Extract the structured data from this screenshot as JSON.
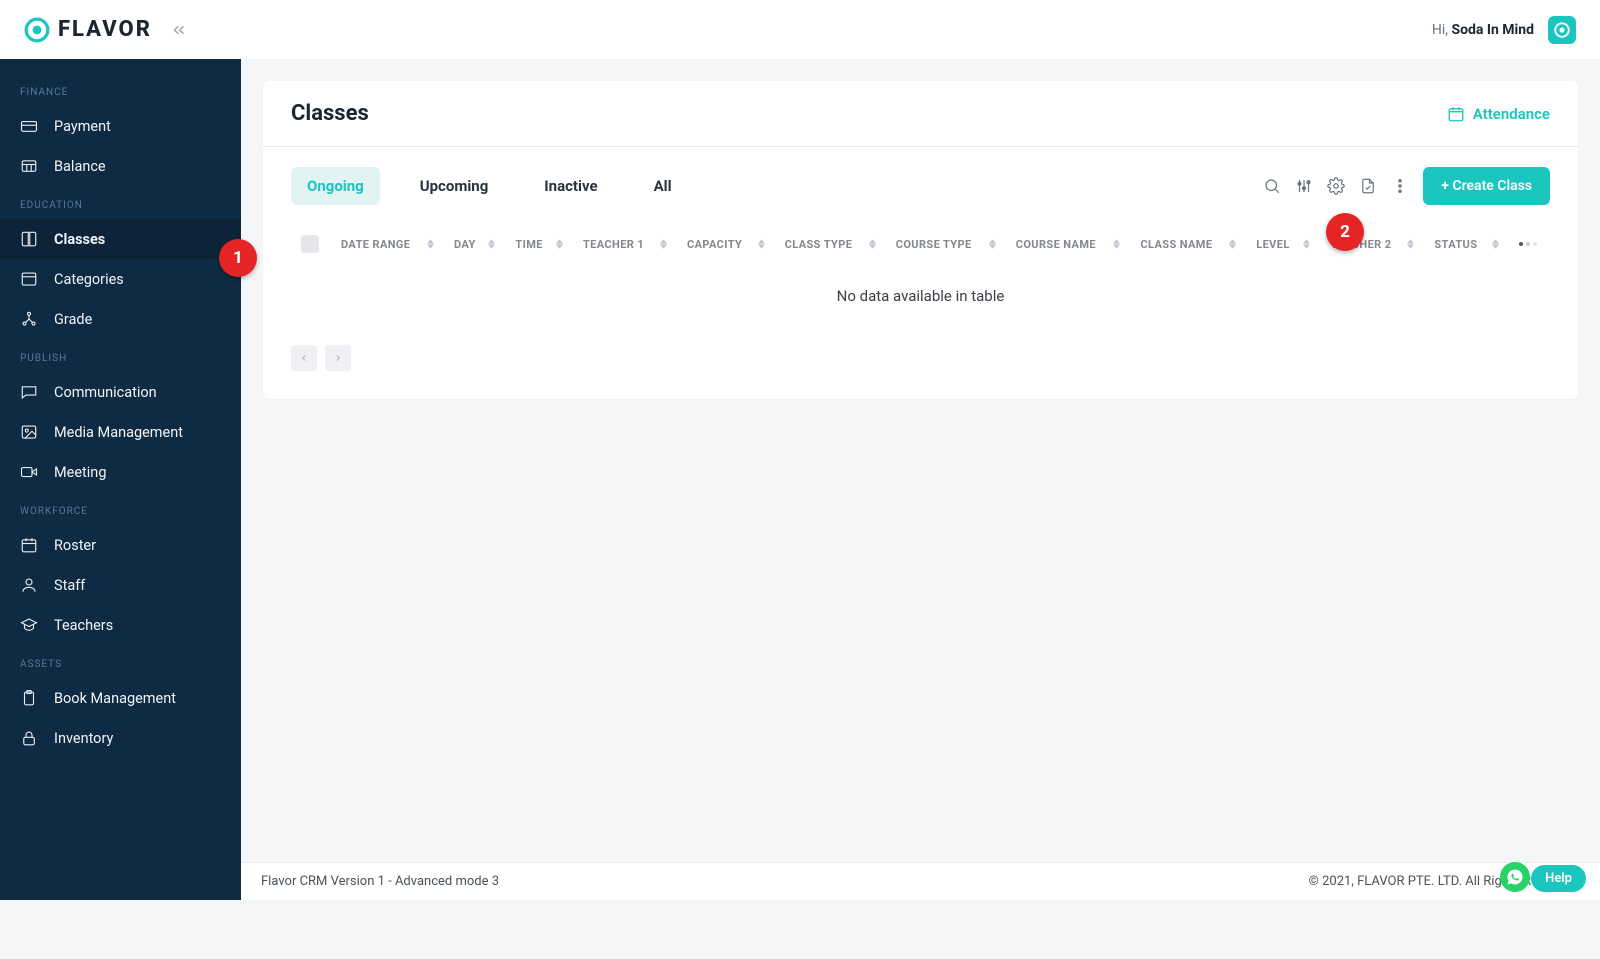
{
  "brand": {
    "name": "FLAVOR"
  },
  "user": {
    "greeting_prefix": "Hi, ",
    "name": "Soda In Mind"
  },
  "markers": {
    "one": "1",
    "two": "2"
  },
  "sidebar": {
    "sections": [
      {
        "title": "FINANCE",
        "items": [
          {
            "label": "Payment",
            "icon": "card-icon"
          },
          {
            "label": "Balance",
            "icon": "table-icon"
          }
        ]
      },
      {
        "title": "EDUCATION",
        "items": [
          {
            "label": "Classes",
            "icon": "book-icon",
            "active": true
          },
          {
            "label": "Categories",
            "icon": "window-icon"
          },
          {
            "label": "Grade",
            "icon": "distribute-icon"
          }
        ]
      },
      {
        "title": "PUBLISH",
        "items": [
          {
            "label": "Communication",
            "icon": "chat-icon"
          },
          {
            "label": "Media Management",
            "icon": "image-icon"
          },
          {
            "label": "Meeting",
            "icon": "video-icon"
          }
        ]
      },
      {
        "title": "WORKFORCE",
        "items": [
          {
            "label": "Roster",
            "icon": "calendar-icon"
          },
          {
            "label": "Staff",
            "icon": "user-icon"
          },
          {
            "label": "Teachers",
            "icon": "cap-icon"
          }
        ]
      },
      {
        "title": "ASSETS",
        "items": [
          {
            "label": "Book Management",
            "icon": "clipboard-icon"
          },
          {
            "label": "Inventory",
            "icon": "lock-icon"
          }
        ]
      }
    ]
  },
  "page": {
    "title": "Classes",
    "attendance_label": "Attendance",
    "tabs": [
      {
        "label": "Ongoing",
        "active": true
      },
      {
        "label": "Upcoming"
      },
      {
        "label": "Inactive"
      },
      {
        "label": "All"
      }
    ],
    "create_button": "+ Create Class",
    "columns": [
      "DATE RANGE",
      "DAY",
      "TIME",
      "TEACHER 1",
      "CAPACITY",
      "CLASS TYPE",
      "COURSE TYPE",
      "COURSE NAME",
      "CLASS NAME",
      "LEVEL",
      "TEACHER 2",
      "STATUS"
    ],
    "empty_message": "No data available in table"
  },
  "footer": {
    "left": "Flavor CRM Version 1 - Advanced mode 3",
    "right": "© 2021, FLAVOR PTE. LTD. All Rights Reserved."
  },
  "help": {
    "label": "Help"
  }
}
